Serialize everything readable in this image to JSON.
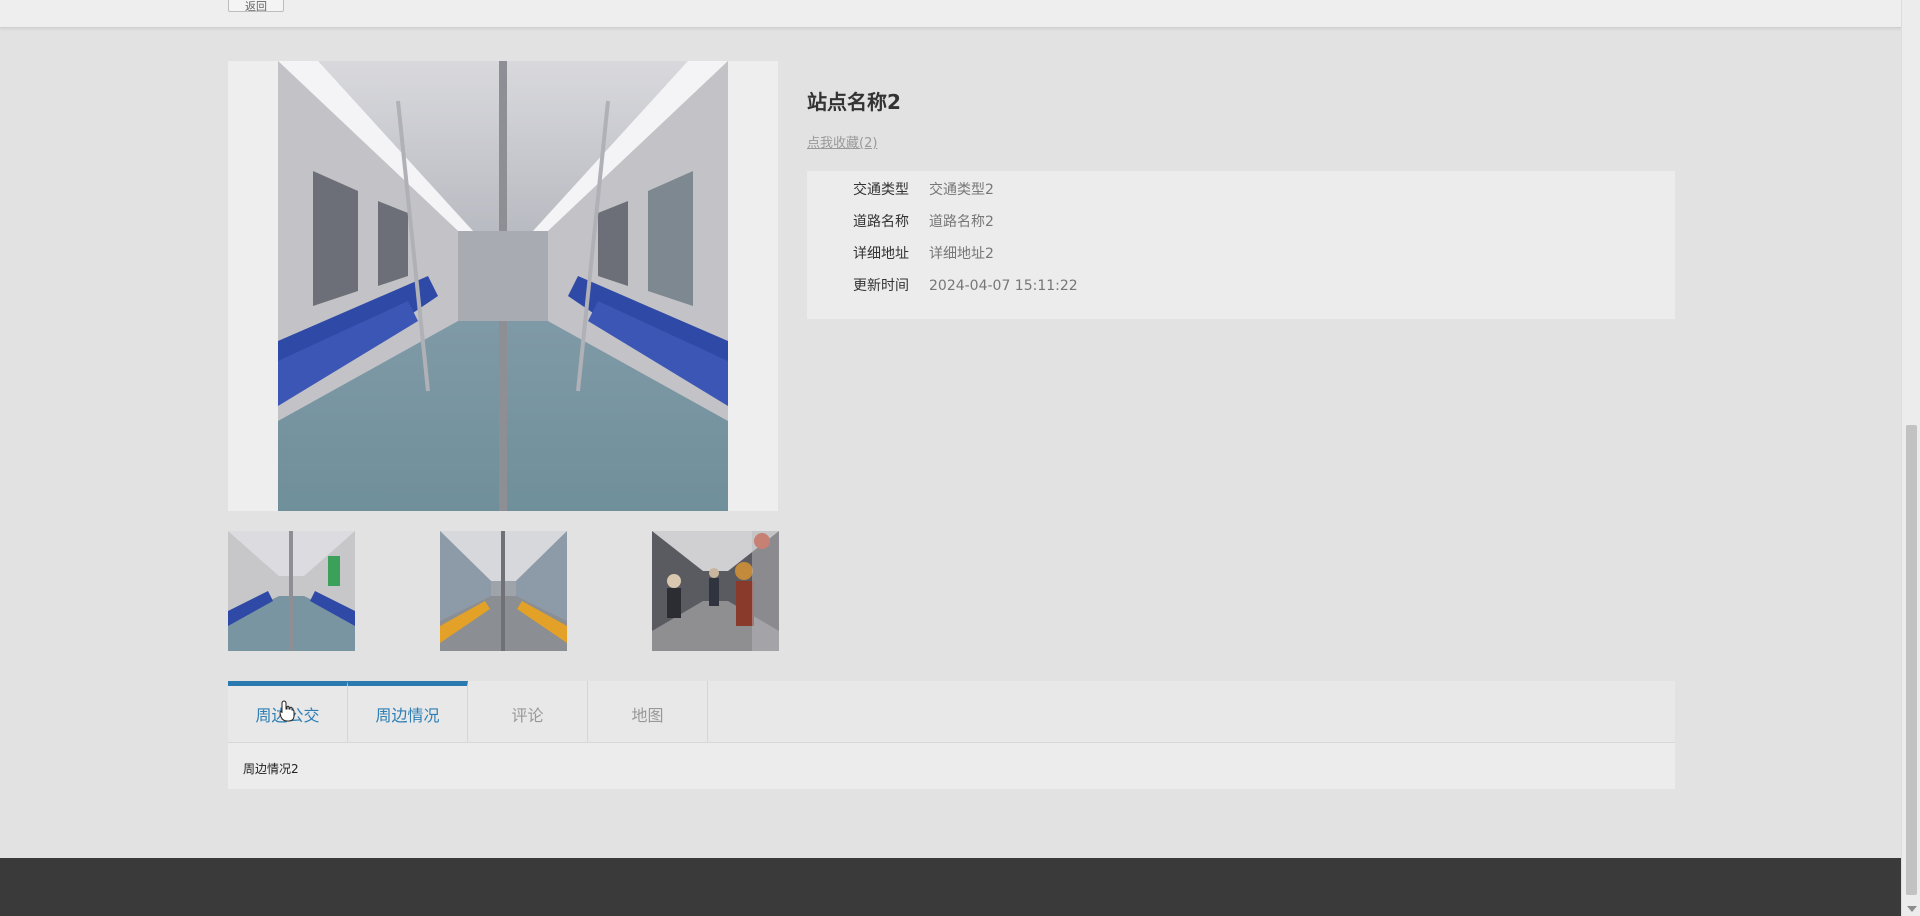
{
  "toolbar": {
    "back_label": "返回"
  },
  "station": {
    "title": "站点名称2",
    "favorite_label": "点我收藏(2)"
  },
  "info": [
    {
      "label": "交通类型",
      "value": "交通类型2"
    },
    {
      "label": "道路名称",
      "value": "道路名称2"
    },
    {
      "label": "详细地址",
      "value": "详细地址2"
    },
    {
      "label": "更新时间",
      "value": "2024-04-07 15:11:22"
    }
  ],
  "tabs": [
    {
      "label": "周边公交"
    },
    {
      "label": "周边情况"
    },
    {
      "label": "评论"
    },
    {
      "label": "地图"
    }
  ],
  "tab_content": "周边情况2",
  "colors": {
    "accent": "#2a7ab0",
    "footer": "#3a3a3a"
  },
  "icons": {
    "cursor": "hand-cursor-icon"
  }
}
